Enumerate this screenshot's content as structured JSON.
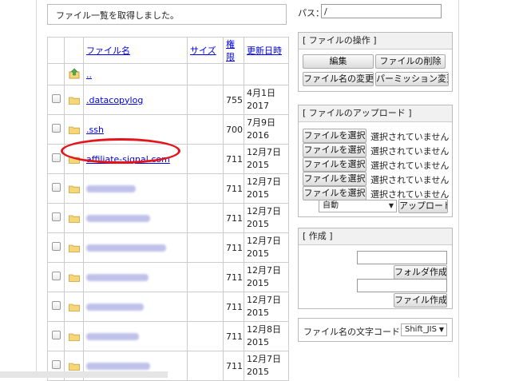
{
  "status_message": "ファイル一覧を取得しました。",
  "path": {
    "label": "パス：",
    "value": "/"
  },
  "table": {
    "headers": {
      "name": "ファイル名",
      "size": "サイズ",
      "perm": "権限",
      "date": "更新日時"
    },
    "parent_label": "..",
    "rows": [
      {
        "name": ".datacopylog",
        "perm": "755",
        "date1": "4月1日",
        "date2": "2017"
      },
      {
        "name": ".ssh",
        "perm": "700",
        "date1": "7月9日",
        "date2": "2016"
      },
      {
        "name": "affiliate-signal.com",
        "perm": "711",
        "date1": "12月7日",
        "date2": "2015"
      },
      {
        "name": "",
        "perm": "711",
        "date1": "12月7日",
        "date2": "2015"
      },
      {
        "name": "",
        "perm": "711",
        "date1": "12月7日",
        "date2": "2015"
      },
      {
        "name": "",
        "perm": "711",
        "date1": "12月7日",
        "date2": "2015"
      },
      {
        "name": "",
        "perm": "711",
        "date1": "12月7日",
        "date2": "2015"
      },
      {
        "name": "",
        "perm": "711",
        "date1": "12月7日",
        "date2": "2015"
      },
      {
        "name": "",
        "perm": "711",
        "date1": "12月8日",
        "date2": "2015"
      },
      {
        "name": "",
        "perm": "711",
        "date1": "12月7日",
        "date2": "2015"
      }
    ]
  },
  "file_ops": {
    "title": "[ ファイルの操作 ]",
    "edit": "編集",
    "delete": "ファイルの削除",
    "rename": "ファイル名の変更",
    "permission": "パーミッション変更"
  },
  "upload": {
    "title": "[ ファイルのアップロード ]",
    "choose": "ファイルを選択",
    "no_file": "選択されていません",
    "mode": "自動",
    "upload_button": "アップロード"
  },
  "create": {
    "title": "[ 作成 ]",
    "folder_button": "フォルダ作成",
    "file_button": "ファイル作成"
  },
  "encoding": {
    "label": "ファイル名の文字コード：",
    "value": "Shift_JIS"
  },
  "colors": {
    "link": "#0000ee",
    "highlight": "#e3141b",
    "folder": "#f5d77a"
  }
}
